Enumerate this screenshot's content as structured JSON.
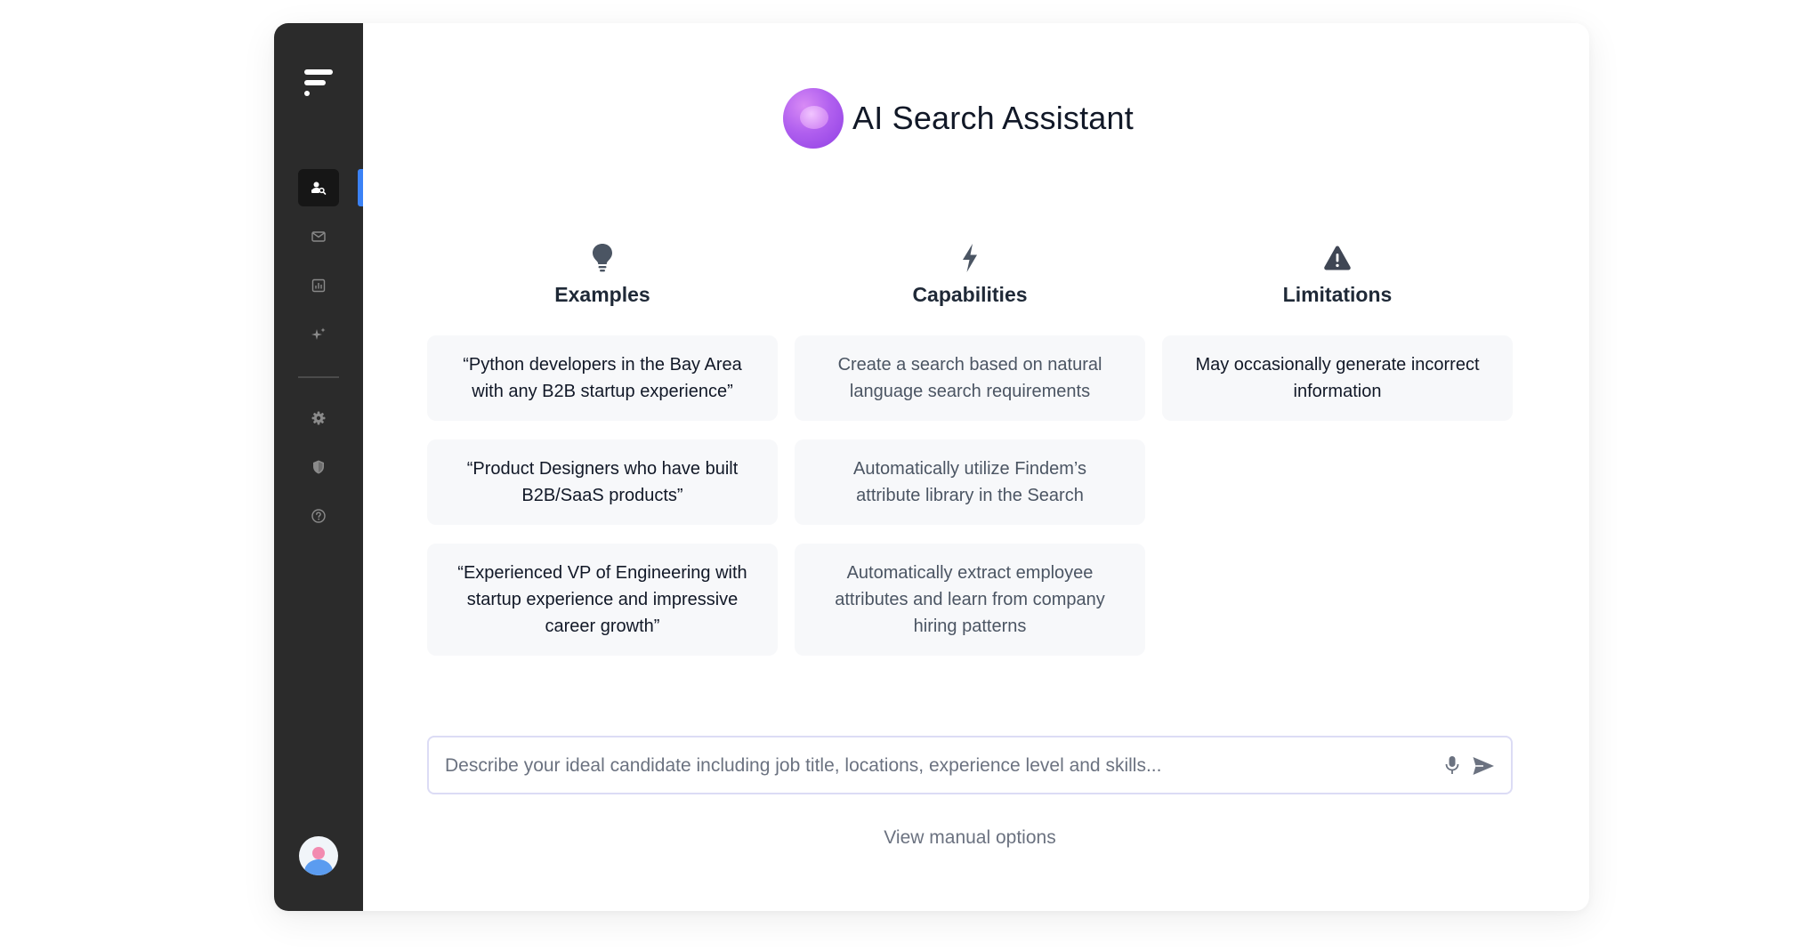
{
  "header": {
    "title": "AI Search Assistant"
  },
  "sidebar": {
    "logo_icon": "findem-logo-icon",
    "items": [
      {
        "name": "people-search",
        "icon": "people-search-icon",
        "active": true
      },
      {
        "name": "messages",
        "icon": "mail-icon",
        "active": false
      },
      {
        "name": "analytics",
        "icon": "chart-icon",
        "active": false
      },
      {
        "name": "ai",
        "icon": "sparkle-icon",
        "active": false
      },
      {
        "name": "settings",
        "icon": "gear-icon",
        "active": false
      },
      {
        "name": "security",
        "icon": "shield-icon",
        "active": false
      },
      {
        "name": "help",
        "icon": "help-icon",
        "active": false
      }
    ],
    "accent_color": "#3b82f6"
  },
  "columns": {
    "examples": {
      "heading": "Examples",
      "icon": "lightbulb-icon",
      "cards": [
        "“Python developers in the Bay Area\nwith any B2B startup experience”",
        "“Product Designers who have built\nB2B/SaaS products”",
        "“Experienced VP of Engineering with\nstartup experience and impressive\ncareer growth”"
      ]
    },
    "capabilities": {
      "heading": "Capabilities",
      "icon": "lightning-icon",
      "cards": [
        "Create a search based on natural\nlanguage search requirements",
        "Automatically utilize Findem’s\nattribute library in the Search",
        "Automatically extract employee\nattributes and learn from company\nhiring patterns"
      ]
    },
    "limitations": {
      "heading": "Limitations",
      "icon": "warning-icon",
      "cards": [
        "May occasionally generate incorrect\ninformation"
      ]
    }
  },
  "search": {
    "value": "",
    "placeholder": "Describe your ideal candidate including job title, locations, experience level and skills..."
  },
  "manual_link": "View manual options"
}
